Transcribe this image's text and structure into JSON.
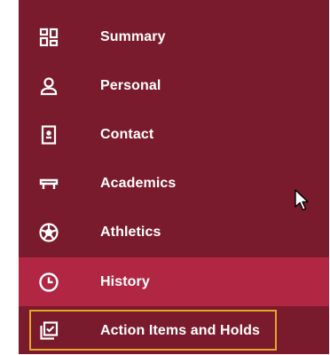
{
  "colors": {
    "sidebar_bg": "#7a1b2d",
    "active_bg": "#b12642",
    "text": "#ffffff",
    "focus_outline": "#e6a72a"
  },
  "nav": {
    "items": [
      {
        "label": "Summary",
        "icon": "dashboard-grid-icon",
        "active": false
      },
      {
        "label": "Personal",
        "icon": "person-icon",
        "active": false
      },
      {
        "label": "Contact",
        "icon": "contact-card-icon",
        "active": false
      },
      {
        "label": "Academics",
        "icon": "graduation-cap-icon",
        "active": false
      },
      {
        "label": "Athletics",
        "icon": "soccer-ball-icon",
        "active": false
      },
      {
        "label": "History",
        "icon": "clock-icon",
        "active": true
      },
      {
        "label": "Action Items and Holds",
        "icon": "checklist-icon",
        "active": false,
        "focused": true
      }
    ]
  }
}
